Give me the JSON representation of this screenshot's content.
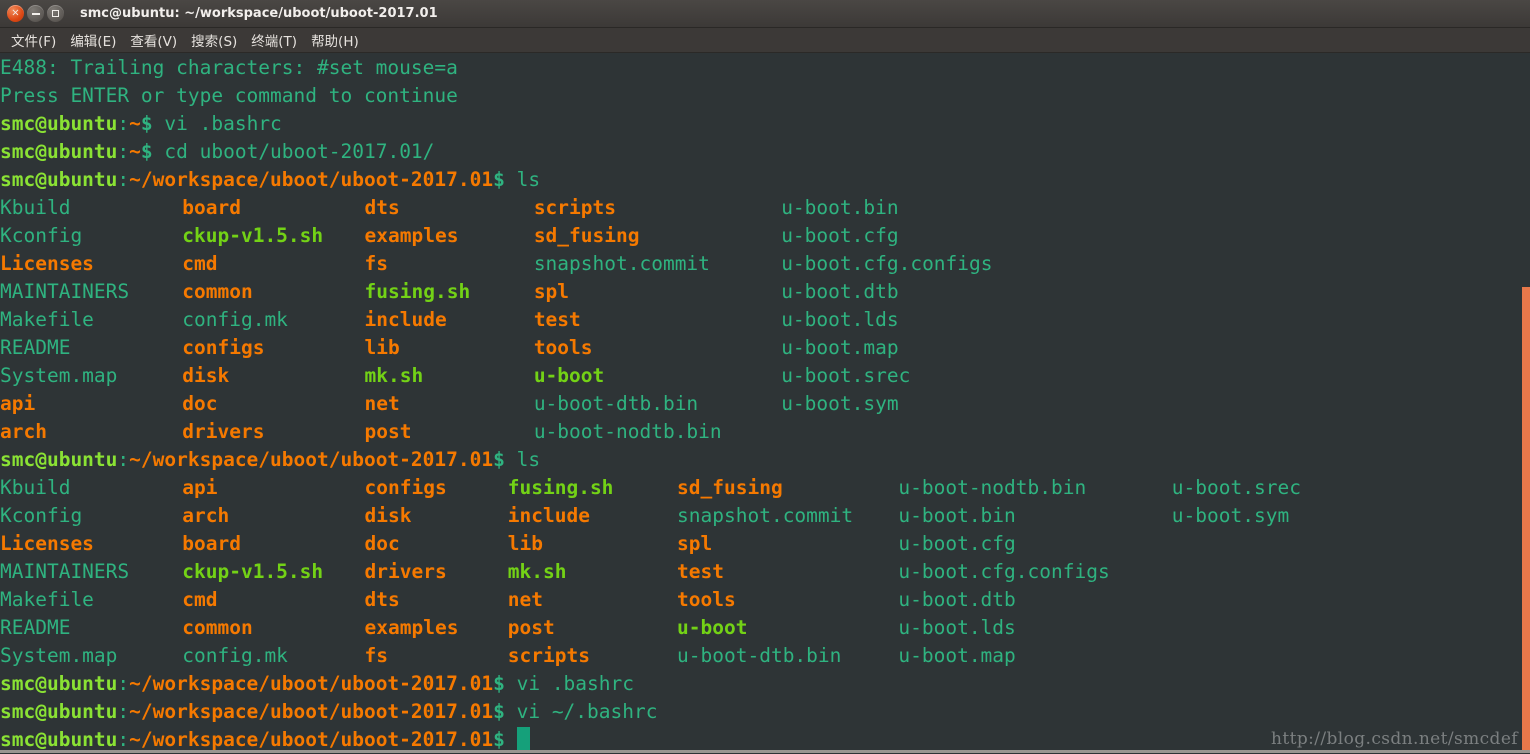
{
  "window": {
    "title": "smc@ubuntu: ~/workspace/uboot/uboot-2017.01",
    "buttons": {
      "close": "×",
      "minimize": "−",
      "maximize": "□"
    }
  },
  "menu": {
    "items": [
      {
        "label": "文件(F)"
      },
      {
        "label": "编辑(E)"
      },
      {
        "label": "查看(V)"
      },
      {
        "label": "搜索(S)"
      },
      {
        "label": "终端(T)"
      },
      {
        "label": "帮助(H)"
      }
    ]
  },
  "colors": {
    "background": "#2e3436",
    "file": "#2fb380",
    "directory": "#f57900",
    "executable": "#73d216",
    "prompt_user": "#8ae234",
    "prompt_path": "#f57900",
    "cursor": "#15a07a",
    "scrollbar": "#e8784a",
    "watermark": "#7b7f80",
    "titlebar": "#3c3937",
    "close_button": "#dd4814"
  },
  "prompt": {
    "user_host": "smc@ubuntu",
    "colon": ":",
    "path_home": "~",
    "path_full": "~/workspace/uboot/uboot-2017.01",
    "dollar": "$"
  },
  "terminal": {
    "vim_error_1": "E488: Trailing characters: #set mouse=a",
    "vim_error_2": "Press ENTER or type command to continue",
    "commands": {
      "vi_bashrc": "vi .bashrc",
      "cd_uboot": "cd uboot/uboot-2017.01/",
      "ls": "ls",
      "vi_tilde_bashrc": "vi ~/.bashrc"
    },
    "ls_output_1": {
      "columns": [
        [
          {
            "name": "Kbuild",
            "type": "file"
          },
          {
            "name": "Kconfig",
            "type": "file"
          },
          {
            "name": "Licenses",
            "type": "directory"
          },
          {
            "name": "MAINTAINERS",
            "type": "file"
          },
          {
            "name": "Makefile",
            "type": "file"
          },
          {
            "name": "README",
            "type": "file"
          },
          {
            "name": "System.map",
            "type": "file"
          },
          {
            "name": "api",
            "type": "directory"
          },
          {
            "name": "arch",
            "type": "directory"
          }
        ],
        [
          {
            "name": "board",
            "type": "directory"
          },
          {
            "name": "ckup-v1.5.sh",
            "type": "executable"
          },
          {
            "name": "cmd",
            "type": "directory"
          },
          {
            "name": "common",
            "type": "directory"
          },
          {
            "name": "config.mk",
            "type": "file"
          },
          {
            "name": "configs",
            "type": "directory"
          },
          {
            "name": "disk",
            "type": "directory"
          },
          {
            "name": "doc",
            "type": "directory"
          },
          {
            "name": "drivers",
            "type": "directory"
          }
        ],
        [
          {
            "name": "dts",
            "type": "directory"
          },
          {
            "name": "examples",
            "type": "directory"
          },
          {
            "name": "fs",
            "type": "directory"
          },
          {
            "name": "fusing.sh",
            "type": "executable"
          },
          {
            "name": "include",
            "type": "directory"
          },
          {
            "name": "lib",
            "type": "directory"
          },
          {
            "name": "mk.sh",
            "type": "executable"
          },
          {
            "name": "net",
            "type": "directory"
          },
          {
            "name": "post",
            "type": "directory"
          }
        ],
        [
          {
            "name": "scripts",
            "type": "directory"
          },
          {
            "name": "sd_fusing",
            "type": "directory"
          },
          {
            "name": "snapshot.commit",
            "type": "file"
          },
          {
            "name": "spl",
            "type": "directory"
          },
          {
            "name": "test",
            "type": "directory"
          },
          {
            "name": "tools",
            "type": "directory"
          },
          {
            "name": "u-boot",
            "type": "executable"
          },
          {
            "name": "u-boot-dtb.bin",
            "type": "file"
          },
          {
            "name": "u-boot-nodtb.bin",
            "type": "file"
          }
        ],
        [
          {
            "name": "u-boot.bin",
            "type": "file"
          },
          {
            "name": "u-boot.cfg",
            "type": "file"
          },
          {
            "name": "u-boot.cfg.configs",
            "type": "file"
          },
          {
            "name": "u-boot.dtb",
            "type": "file"
          },
          {
            "name": "u-boot.lds",
            "type": "file"
          },
          {
            "name": "u-boot.map",
            "type": "file"
          },
          {
            "name": "u-boot.srec",
            "type": "file"
          },
          {
            "name": "u-boot.sym",
            "type": "file"
          }
        ]
      ]
    },
    "ls_output_2": {
      "columns": [
        [
          {
            "name": "Kbuild",
            "type": "file"
          },
          {
            "name": "Kconfig",
            "type": "file"
          },
          {
            "name": "Licenses",
            "type": "directory"
          },
          {
            "name": "MAINTAINERS",
            "type": "file"
          },
          {
            "name": "Makefile",
            "type": "file"
          },
          {
            "name": "README",
            "type": "file"
          },
          {
            "name": "System.map",
            "type": "file"
          }
        ],
        [
          {
            "name": "api",
            "type": "directory"
          },
          {
            "name": "arch",
            "type": "directory"
          },
          {
            "name": "board",
            "type": "directory"
          },
          {
            "name": "ckup-v1.5.sh",
            "type": "executable"
          },
          {
            "name": "cmd",
            "type": "directory"
          },
          {
            "name": "common",
            "type": "directory"
          },
          {
            "name": "config.mk",
            "type": "file"
          }
        ],
        [
          {
            "name": "configs",
            "type": "directory"
          },
          {
            "name": "disk",
            "type": "directory"
          },
          {
            "name": "doc",
            "type": "directory"
          },
          {
            "name": "drivers",
            "type": "directory"
          },
          {
            "name": "dts",
            "type": "directory"
          },
          {
            "name": "examples",
            "type": "directory"
          },
          {
            "name": "fs",
            "type": "directory"
          }
        ],
        [
          {
            "name": "fusing.sh",
            "type": "executable"
          },
          {
            "name": "include",
            "type": "directory"
          },
          {
            "name": "lib",
            "type": "directory"
          },
          {
            "name": "mk.sh",
            "type": "executable"
          },
          {
            "name": "net",
            "type": "directory"
          },
          {
            "name": "post",
            "type": "directory"
          },
          {
            "name": "scripts",
            "type": "directory"
          }
        ],
        [
          {
            "name": "sd_fusing",
            "type": "directory"
          },
          {
            "name": "snapshot.commit",
            "type": "file"
          },
          {
            "name": "spl",
            "type": "directory"
          },
          {
            "name": "test",
            "type": "directory"
          },
          {
            "name": "tools",
            "type": "directory"
          },
          {
            "name": "u-boot",
            "type": "executable"
          },
          {
            "name": "u-boot-dtb.bin",
            "type": "file"
          }
        ],
        [
          {
            "name": "u-boot-nodtb.bin",
            "type": "file"
          },
          {
            "name": "u-boot.bin",
            "type": "file"
          },
          {
            "name": "u-boot.cfg",
            "type": "file"
          },
          {
            "name": "u-boot.cfg.configs",
            "type": "file"
          },
          {
            "name": "u-boot.dtb",
            "type": "file"
          },
          {
            "name": "u-boot.lds",
            "type": "file"
          },
          {
            "name": "u-boot.map",
            "type": "file"
          }
        ],
        [
          {
            "name": "u-boot.srec",
            "type": "file"
          },
          {
            "name": "u-boot.sym",
            "type": "file"
          }
        ]
      ]
    }
  },
  "watermark": {
    "text": "http://blog.csdn.net/smcdef"
  }
}
